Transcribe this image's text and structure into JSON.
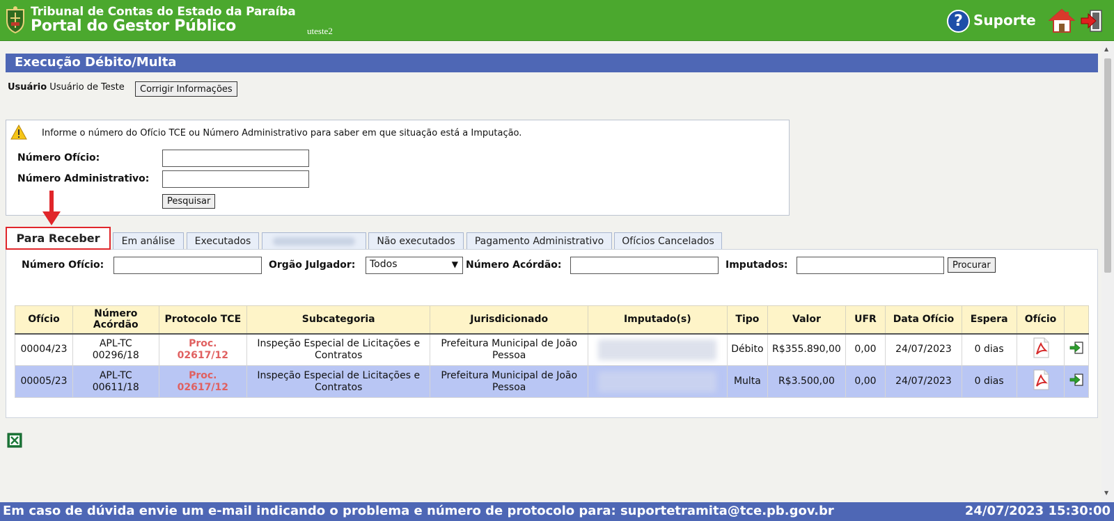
{
  "header": {
    "org_name": "Tribunal de Contas do Estado da Paraíba",
    "portal_name": "Portal do Gestor Público",
    "username": "uteste2",
    "help_label": "Suporte",
    "help_glyph": "?",
    "bg_color": "#4ba82e"
  },
  "page": {
    "title": "Execução Débito/Multa",
    "user_label": "Usuário",
    "user_name": "Usuário de Teste",
    "fix_button": "Corrigir Informações"
  },
  "search": {
    "hint": "Informe o número do Ofício TCE ou Número Administrativo para saber em que situação está a Imputação.",
    "oficio_label": "Número Ofício:",
    "oficio_value": "",
    "admin_label": "Número Administrativo:",
    "admin_value": "",
    "button": "Pesquisar"
  },
  "tabs": [
    {
      "label": "Para Receber",
      "active": true
    },
    {
      "label": "Em análise"
    },
    {
      "label": "Executados"
    },
    {
      "label": "",
      "blurred": true
    },
    {
      "label": "Não executados"
    },
    {
      "label": "Pagamento Administrativo"
    },
    {
      "label": "Ofícios Cancelados"
    }
  ],
  "filters": {
    "oficio_label": "Número Ofício:",
    "oficio_value": "",
    "orgao_label": "Orgão Julgador:",
    "orgao_selected": "Todos",
    "acordao_label": "Número Acórdão:",
    "acordao_value": "",
    "imputados_label": "Imputados:",
    "imputados_value": "",
    "button": "Procurar"
  },
  "table": {
    "headers": [
      "Ofício",
      "Número Acórdão",
      "Protocolo TCE",
      "Subcategoria",
      "Jurisdicionado",
      "Imputado(s)",
      "Tipo",
      "Valor",
      "UFR",
      "Data Ofício",
      "Espera",
      "Ofício",
      ""
    ],
    "rows": [
      {
        "oficio": "00004/23",
        "acordao": "APL-TC 00296/18",
        "protocolo": "Proc. 02617/12",
        "subcategoria": "Inspeção Especial de Licitações e Contratos",
        "jurisdicionado": "Prefeitura Municipal de João Pessoa",
        "tipo": "Débito",
        "valor": "R$355.890,00",
        "ufr": "0,00",
        "data": "24/07/2023",
        "espera": "0 dias"
      },
      {
        "oficio": "00005/23",
        "acordao": "APL-TC 00611/18",
        "protocolo": "Proc. 02617/12",
        "subcategoria": "Inspeção Especial de Licitações e Contratos",
        "jurisdicionado": "Prefeitura Municipal de João Pessoa",
        "tipo": "Multa",
        "valor": "R$3.500,00",
        "ufr": "0,00",
        "data": "24/07/2023",
        "espera": "0 dias"
      }
    ]
  },
  "footer": {
    "message": "Em caso de dúvida envie um e-mail indicando o problema e número de protocolo para: suportetramita@tce.pb.gov.br",
    "datetime": "24/07/2023 15:30:00"
  },
  "colors": {
    "title_bar": "#4e67b5",
    "table_header": "#fef4c8",
    "selected_row": "#b9c6f4",
    "active_tab_border": "#e0262a",
    "protocol_text": "#e06060"
  }
}
